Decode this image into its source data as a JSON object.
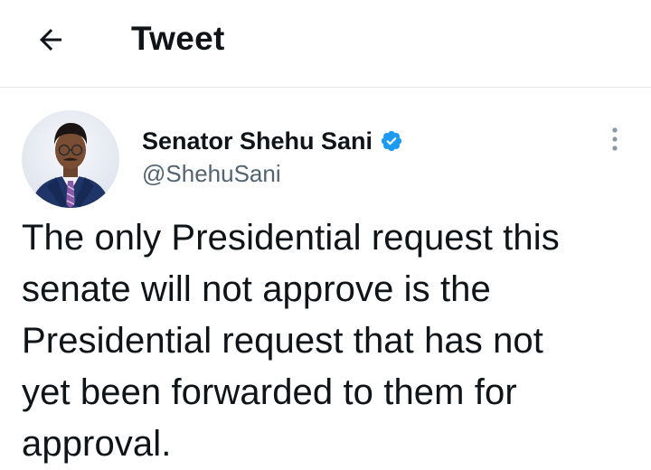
{
  "header": {
    "back_icon": "arrow-left-icon",
    "title": "Tweet"
  },
  "author": {
    "display_name": "Senator Shehu Sani",
    "handle": "@ShehuSani",
    "verified_icon": "verified-badge-icon",
    "verified_color": "#1d9bf0",
    "avatar_icon": "profile-photo"
  },
  "menu": {
    "more_icon": "more-vertical-icon"
  },
  "tweet": {
    "text": "The only Presidential request this\nsenate will not approve is the\nPresidential request that has not\nyet been forwarded to them for\napproval."
  },
  "colors": {
    "text_primary": "#0f1419",
    "text_secondary": "#536471",
    "divider": "#e6e6e6",
    "accent": "#1d9bf0"
  }
}
